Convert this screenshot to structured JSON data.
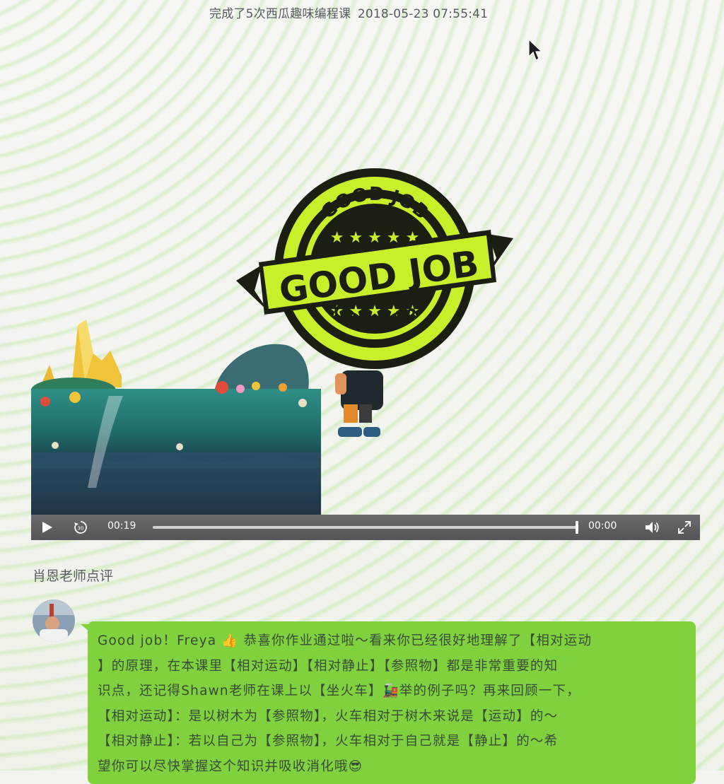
{
  "header": {
    "completed_text": "完成了5次西瓜趣味编程课",
    "timestamp": "2018-05-23 07:55:41"
  },
  "video": {
    "current_time": "00:19",
    "duration": "00:00",
    "progress": 1.0,
    "icons": {
      "play": "play-icon",
      "replay": "replay-30-icon",
      "volume": "volume-icon",
      "fullscreen": "fullscreen-icon"
    },
    "stamp_text_top": "GOOD JOB",
    "stamp_text_center": "GOOD JOB",
    "stamp_text_bottom": "GOOD JOB"
  },
  "review": {
    "section_title": "肖恩老师点评",
    "lines": [
      "Good job！Freya 👍 恭喜你作业通过啦～看来你已经很好地理解了【相对运动",
      "】的原理，在本课里【相对运动】【相对静止】【参照物】都是非常重要的知",
      "识点，还记得Shawn老师在课上以【坐火车】🚂举的例子吗？再来回顾一下，",
      "【相对运动】：是以树木为【参照物】，火车相对于树木来说是【运动】的～",
      "【相对静止】：若以自己为【参照物】，火车相对于自己就是【静止】的～希",
      "望你可以尽快掌握这个知识并吸收消化哦😎"
    ]
  },
  "colors": {
    "bubble": "#7fd23e",
    "stamp": "#c8f02a",
    "controls": "#5f5e62"
  }
}
